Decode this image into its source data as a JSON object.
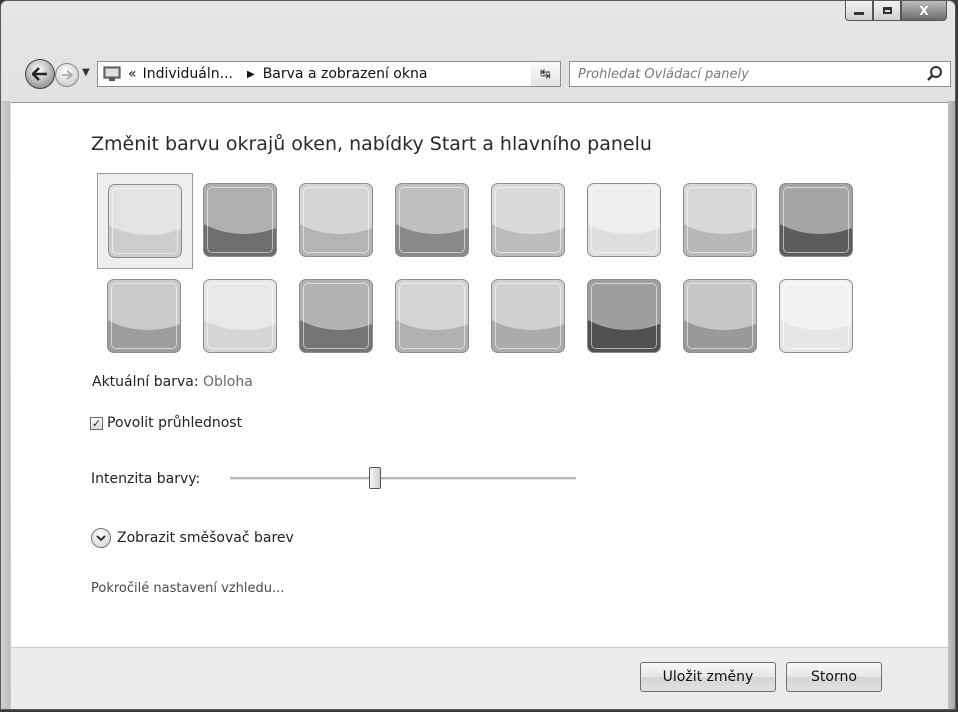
{
  "window": {
    "caption_buttons": {
      "minimize_icon": "minimize-icon",
      "maximize_icon": "maximize-icon",
      "close_icon": "close-icon",
      "close_glyph": "X"
    }
  },
  "navbar": {
    "breadcrumb_prefix": "«",
    "breadcrumb": [
      "Individuáln...",
      "Barva a zobrazení okna"
    ],
    "separator": "▶",
    "dropdown": "▾",
    "refresh": "↹",
    "search_placeholder": "Prohledat Ovládací panely"
  },
  "main": {
    "title": "Změnit barvu okrajů oken, nabídky Start a hlavního panelu",
    "swatches": [
      {
        "color": "#cdcdcd",
        "selected": true
      },
      {
        "color": "#6e6e6e"
      },
      {
        "color": "#b4b4b4"
      },
      {
        "color": "#8a8a8a"
      },
      {
        "color": "#bdbdbd"
      },
      {
        "color": "#dedede"
      },
      {
        "color": "#b8b8b8"
      },
      {
        "color": "#5c5c5c"
      },
      {
        "color": "#9e9e9e"
      },
      {
        "color": "#d6d6d6"
      },
      {
        "color": "#757575"
      },
      {
        "color": "#b1b1b1"
      },
      {
        "color": "#ababab"
      },
      {
        "color": "#505050"
      },
      {
        "color": "#9a9a9a"
      },
      {
        "color": "#e6e6e6"
      }
    ],
    "current_color_label": "Aktuální barva:",
    "current_color_value": "Obloha",
    "transparency_label": "Povolit průhlednost",
    "transparency_checked": true,
    "intensity_label": "Intenzita barvy:",
    "intensity_value": 0.42,
    "mixer_label": "Zobrazit směšovač barev",
    "advanced_link": "Pokročilé nastavení vzhledu..."
  },
  "footer": {
    "save_label": "Uložit změny",
    "cancel_label": "Storno"
  }
}
